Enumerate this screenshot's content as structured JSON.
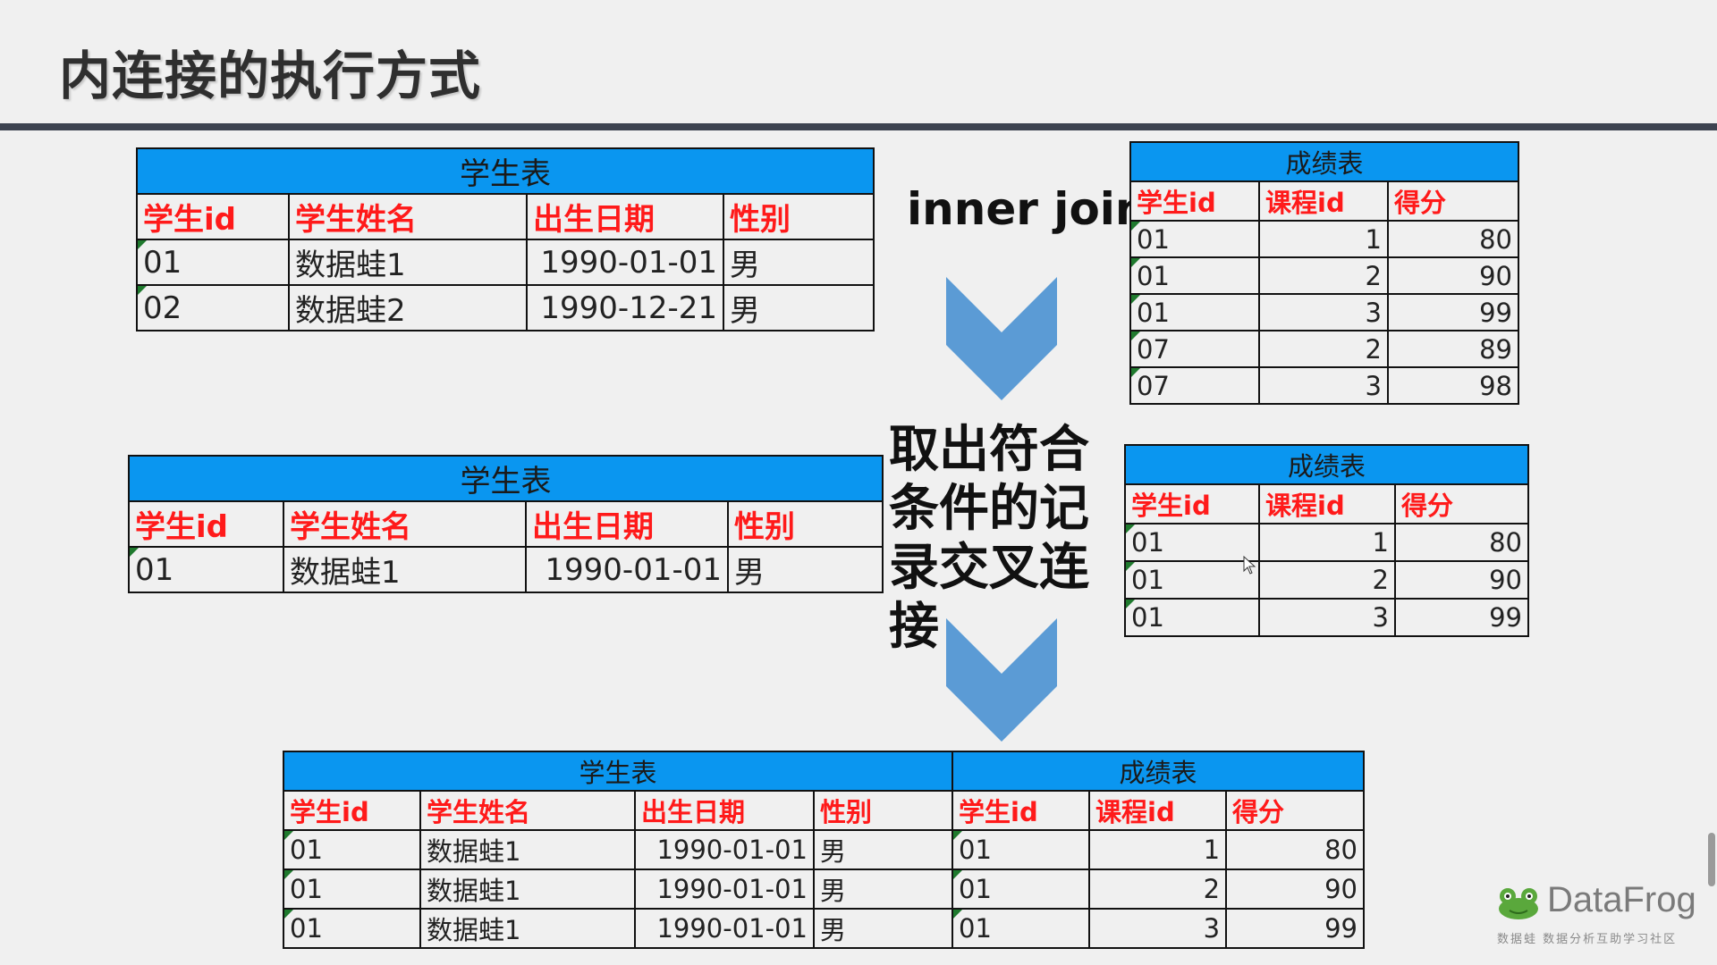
{
  "slide": {
    "title": "内连接的执行方式",
    "inner_join_label": "inner join",
    "explanation": "取出符合条件的记录交叉连接"
  },
  "table_caption_student": "学生表",
  "table_caption_score": "成绩表",
  "student_headers": [
    "学生id",
    "学生姓名",
    "出生日期",
    "性别"
  ],
  "score_headers": [
    "学生id",
    "课程id",
    "得分"
  ],
  "student_table_full": [
    [
      "01",
      "数据蛙1",
      "1990-01-01",
      "男"
    ],
    [
      "02",
      "数据蛙2",
      "1990-12-21",
      "男"
    ]
  ],
  "score_table_full": [
    [
      "01",
      "1",
      "80"
    ],
    [
      "01",
      "2",
      "90"
    ],
    [
      "01",
      "3",
      "99"
    ],
    [
      "07",
      "2",
      "89"
    ],
    [
      "07",
      "3",
      "98"
    ]
  ],
  "student_table_filtered": [
    [
      "01",
      "数据蛙1",
      "1990-01-01",
      "男"
    ]
  ],
  "score_table_filtered": [
    [
      "01",
      "1",
      "80"
    ],
    [
      "01",
      "2",
      "90"
    ],
    [
      "01",
      "3",
      "99"
    ]
  ],
  "result_rows": [
    [
      "01",
      "数据蛙1",
      "1990-01-01",
      "男",
      "01",
      "1",
      "80"
    ],
    [
      "01",
      "数据蛙1",
      "1990-01-01",
      "男",
      "01",
      "2",
      "90"
    ],
    [
      "01",
      "数据蛙1",
      "1990-01-01",
      "男",
      "01",
      "3",
      "99"
    ]
  ],
  "logo": {
    "name": "DataFrog",
    "subtitle": "数据蛙   数据分析互助学习社区"
  },
  "colors": {
    "caption_fill": "#0a96f0",
    "header_text": "#ff1a1a",
    "chevron_fill": "#5b9bd5",
    "title_rule": "#3d4350"
  }
}
